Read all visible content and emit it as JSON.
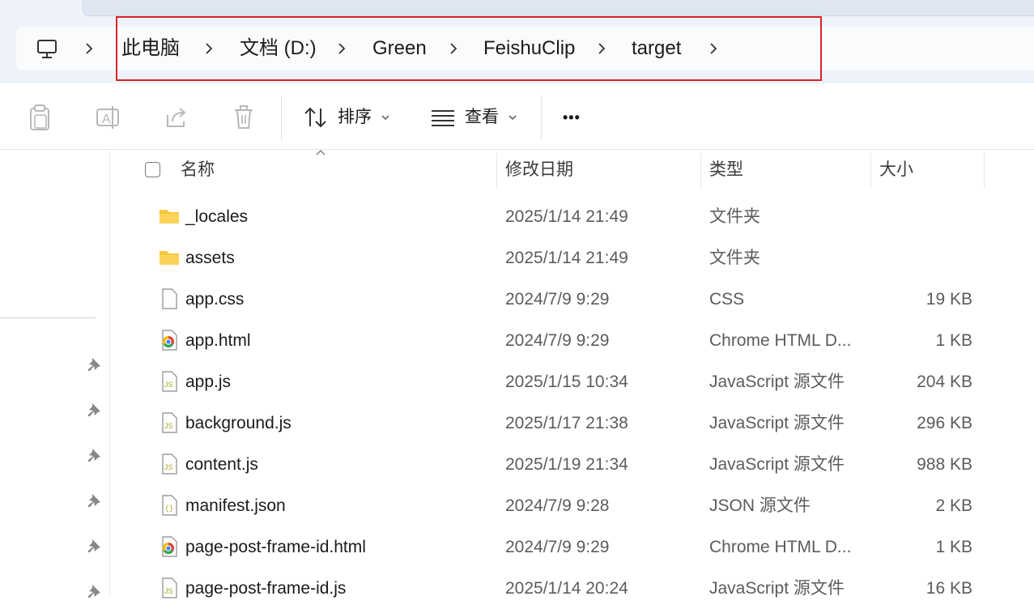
{
  "address_bar": {
    "breadcrumbs": [
      "此电脑",
      "文档 (D:)",
      "Green",
      "FeishuClip",
      "target"
    ],
    "root_icon": "computer-icon",
    "separator_icon": "chevron-right-icon"
  },
  "toolbar": {
    "icon_buttons": [
      "copy-icon",
      "rename-icon",
      "share-icon",
      "delete-icon"
    ],
    "sort_label": "排序",
    "view_label": "查看",
    "more_label": "•••"
  },
  "columns": {
    "name": "名称",
    "date": "修改日期",
    "type": "类型",
    "size": "大小"
  },
  "files": [
    {
      "name": "_locales",
      "date": "2025/1/14 21:49",
      "type": "文件夹",
      "size": "",
      "icon": "folder-icon"
    },
    {
      "name": "assets",
      "date": "2025/1/14 21:49",
      "type": "文件夹",
      "size": "",
      "icon": "folder-icon"
    },
    {
      "name": "app.css",
      "date": "2024/7/9 9:29",
      "type": "CSS",
      "size": "19 KB",
      "icon": "file-icon"
    },
    {
      "name": "app.html",
      "date": "2024/7/9 9:29",
      "type": "Chrome HTML D...",
      "size": "1 KB",
      "icon": "chrome-icon"
    },
    {
      "name": "app.js",
      "date": "2025/1/15 10:34",
      "type": "JavaScript 源文件",
      "size": "204 KB",
      "icon": "js-file-icon"
    },
    {
      "name": "background.js",
      "date": "2025/1/17 21:38",
      "type": "JavaScript 源文件",
      "size": "296 KB",
      "icon": "js-file-icon"
    },
    {
      "name": "content.js",
      "date": "2025/1/19 21:34",
      "type": "JavaScript 源文件",
      "size": "988 KB",
      "icon": "js-file-icon"
    },
    {
      "name": "manifest.json",
      "date": "2024/7/9 9:28",
      "type": "JSON 源文件",
      "size": "2 KB",
      "icon": "json-file-icon"
    },
    {
      "name": "page-post-frame-id.html",
      "date": "2024/7/9 9:29",
      "type": "Chrome HTML D...",
      "size": "1 KB",
      "icon": "chrome-icon"
    },
    {
      "name": "page-post-frame-id.js",
      "date": "2025/1/14 20:24",
      "type": "JavaScript 源文件",
      "size": "16 KB",
      "icon": "js-file-icon"
    }
  ],
  "colors": {
    "highlight_box": "#d9222a",
    "folder": "#f8c63d",
    "js_icon": "#a8a820"
  }
}
